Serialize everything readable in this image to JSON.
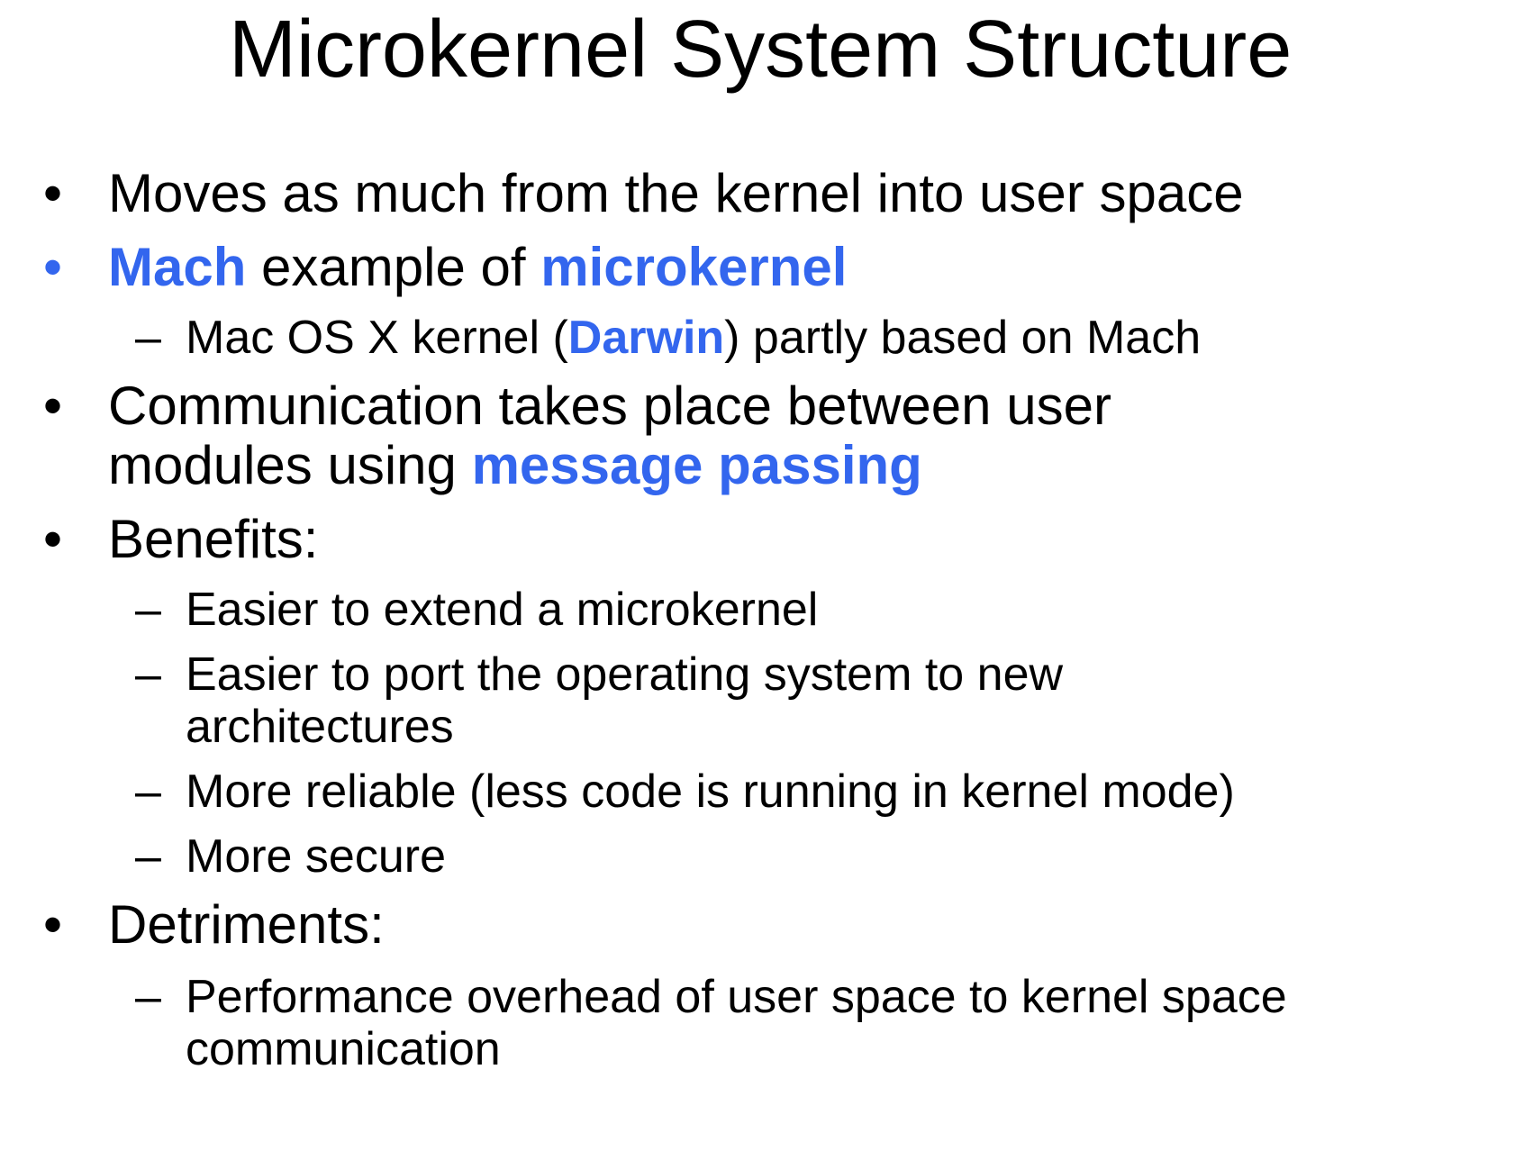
{
  "title": "Microkernel System Structure",
  "bullet_glyph": "•",
  "dash_glyph": "–",
  "items": {
    "b1": {
      "text": "Moves as much from the kernel into user space"
    },
    "b2": {
      "part1": "Mach",
      "part2": " example of ",
      "part3": "microkernel"
    },
    "s1": {
      "part1": "Mac OS X kernel (",
      "part2": "Darwin",
      "part3": ") partly based on Mach"
    },
    "b3": {
      "line1": "Communication takes place between user",
      "line2a": "modules using ",
      "line2b": "message passing"
    },
    "b4": {
      "text": "Benefits:"
    },
    "s2": {
      "text": "Easier to extend a microkernel"
    },
    "s3": {
      "line1": "Easier to port the operating system to new",
      "line2": "architectures"
    },
    "s4": {
      "text": "More reliable (less code is running in kernel mode)"
    },
    "s5": {
      "text": "More secure"
    },
    "b5": {
      "text": "Detriments:"
    },
    "s6": {
      "line1": "Performance overhead of user space to kernel space",
      "line2": "communication"
    }
  },
  "colors": {
    "accent": "#3366ee",
    "text": "#000000",
    "background": "#ffffff"
  }
}
